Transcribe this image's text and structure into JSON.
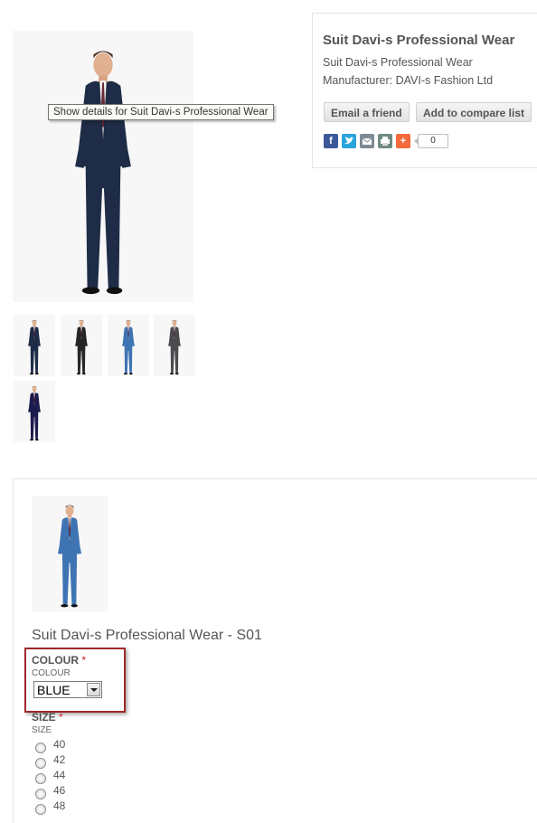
{
  "product": {
    "title": "Suit Davi-s Professional Wear",
    "subtitle": "Suit Davi-s Professional Wear",
    "manufacturer_label": "Manufacturer:",
    "manufacturer_name": "DAVI-s Fashion Ltd",
    "tooltip": "Show details for Suit Davi-s Professional Wear"
  },
  "actions": {
    "email_label": "Email a friend",
    "compare_label": "Add to compare list"
  },
  "share": {
    "count": "0",
    "buttons": [
      "facebook-icon",
      "twitter-icon",
      "email-icon",
      "print-icon",
      "addthis-plus-icon"
    ],
    "colors": {
      "facebook": "#3b5998",
      "twitter": "#2ba4dc",
      "email": "#7d8b95",
      "print": "#6f8a84",
      "addthis": "#f26a3b"
    }
  },
  "thumbnails": [
    {
      "suit_color": "navy",
      "hex": "#1e2c47"
    },
    {
      "suit_color": "black",
      "hex": "#262626"
    },
    {
      "suit_color": "blue",
      "hex": "#3f74b3"
    },
    {
      "suit_color": "grey",
      "hex": "#4a4a4f"
    },
    {
      "suit_color": "dark blue",
      "hex": "#1c1b4e"
    }
  ],
  "child_product": {
    "title": "Suit Davi-s Professional Wear - S01",
    "colour": {
      "label": "COLOUR",
      "required_mark": "*",
      "sublabel": "COLOUR",
      "selected": "BLUE"
    },
    "size": {
      "label": "SIZE",
      "required_mark": "*",
      "sublabel": "SIZE",
      "options": [
        "40",
        "42",
        "44",
        "46",
        "48"
      ]
    }
  },
  "colors": {
    "highlight_border": "#a0262b",
    "required": "#c8202e",
    "text": "#555555"
  }
}
